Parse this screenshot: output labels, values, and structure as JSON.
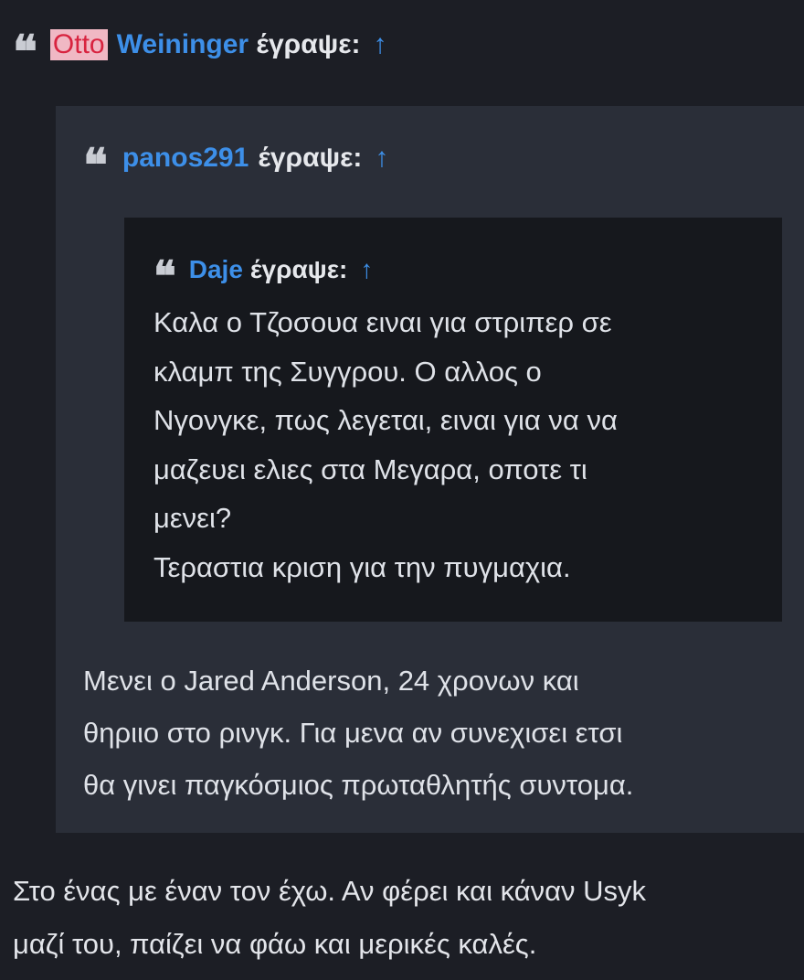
{
  "post": {
    "quote_level_1": {
      "highlighted_term": "Otto",
      "author": "Weininger",
      "wrote_label": "έγραψε:",
      "jump_icon": "↑",
      "quote_level_2": {
        "author": "panos291",
        "wrote_label": "έγραψε:",
        "jump_icon": "↑",
        "quote_level_3": {
          "author": "Daje",
          "wrote_label": "έγραψε:",
          "jump_icon": "↑",
          "lines": [
            "Καλα ο Τζοσουα ειναι για στριπερ σε",
            "κλαμπ της Συγγρου. Ο αλλος ο",
            "Νγονγκε, πως λεγεται, ειναι για να να",
            "μαζευει ελιες στα Μεγαρα, οποτε τι",
            "μενει?",
            "Τεραστια κριση για την πυγμαχια."
          ]
        },
        "lines": [
          "Μενει ο Jared Anderson, 24 χρονων και",
          "θηριιο στο ρινγκ. Για μενα αν συνεχισει ετσι",
          "θα γινει παγκόσμιος πρωταθλητής συντομα."
        ]
      }
    },
    "lines": [
      "Στο ένας με έναν τον έχω. Αν φέρει και κάναν Usyk",
      "μαζί του, παίζει να φάω και μερικές καλές."
    ],
    "quote_mark_glyph": "❝"
  },
  "colors": {
    "background": "#1c1e25",
    "quote_box_outer": "#2a2e38",
    "quote_box_inner": "#16181d",
    "link_blue": "#3d8fe8",
    "highlight_bg": "#f0b8c4",
    "highlight_text": "#d8233f"
  }
}
